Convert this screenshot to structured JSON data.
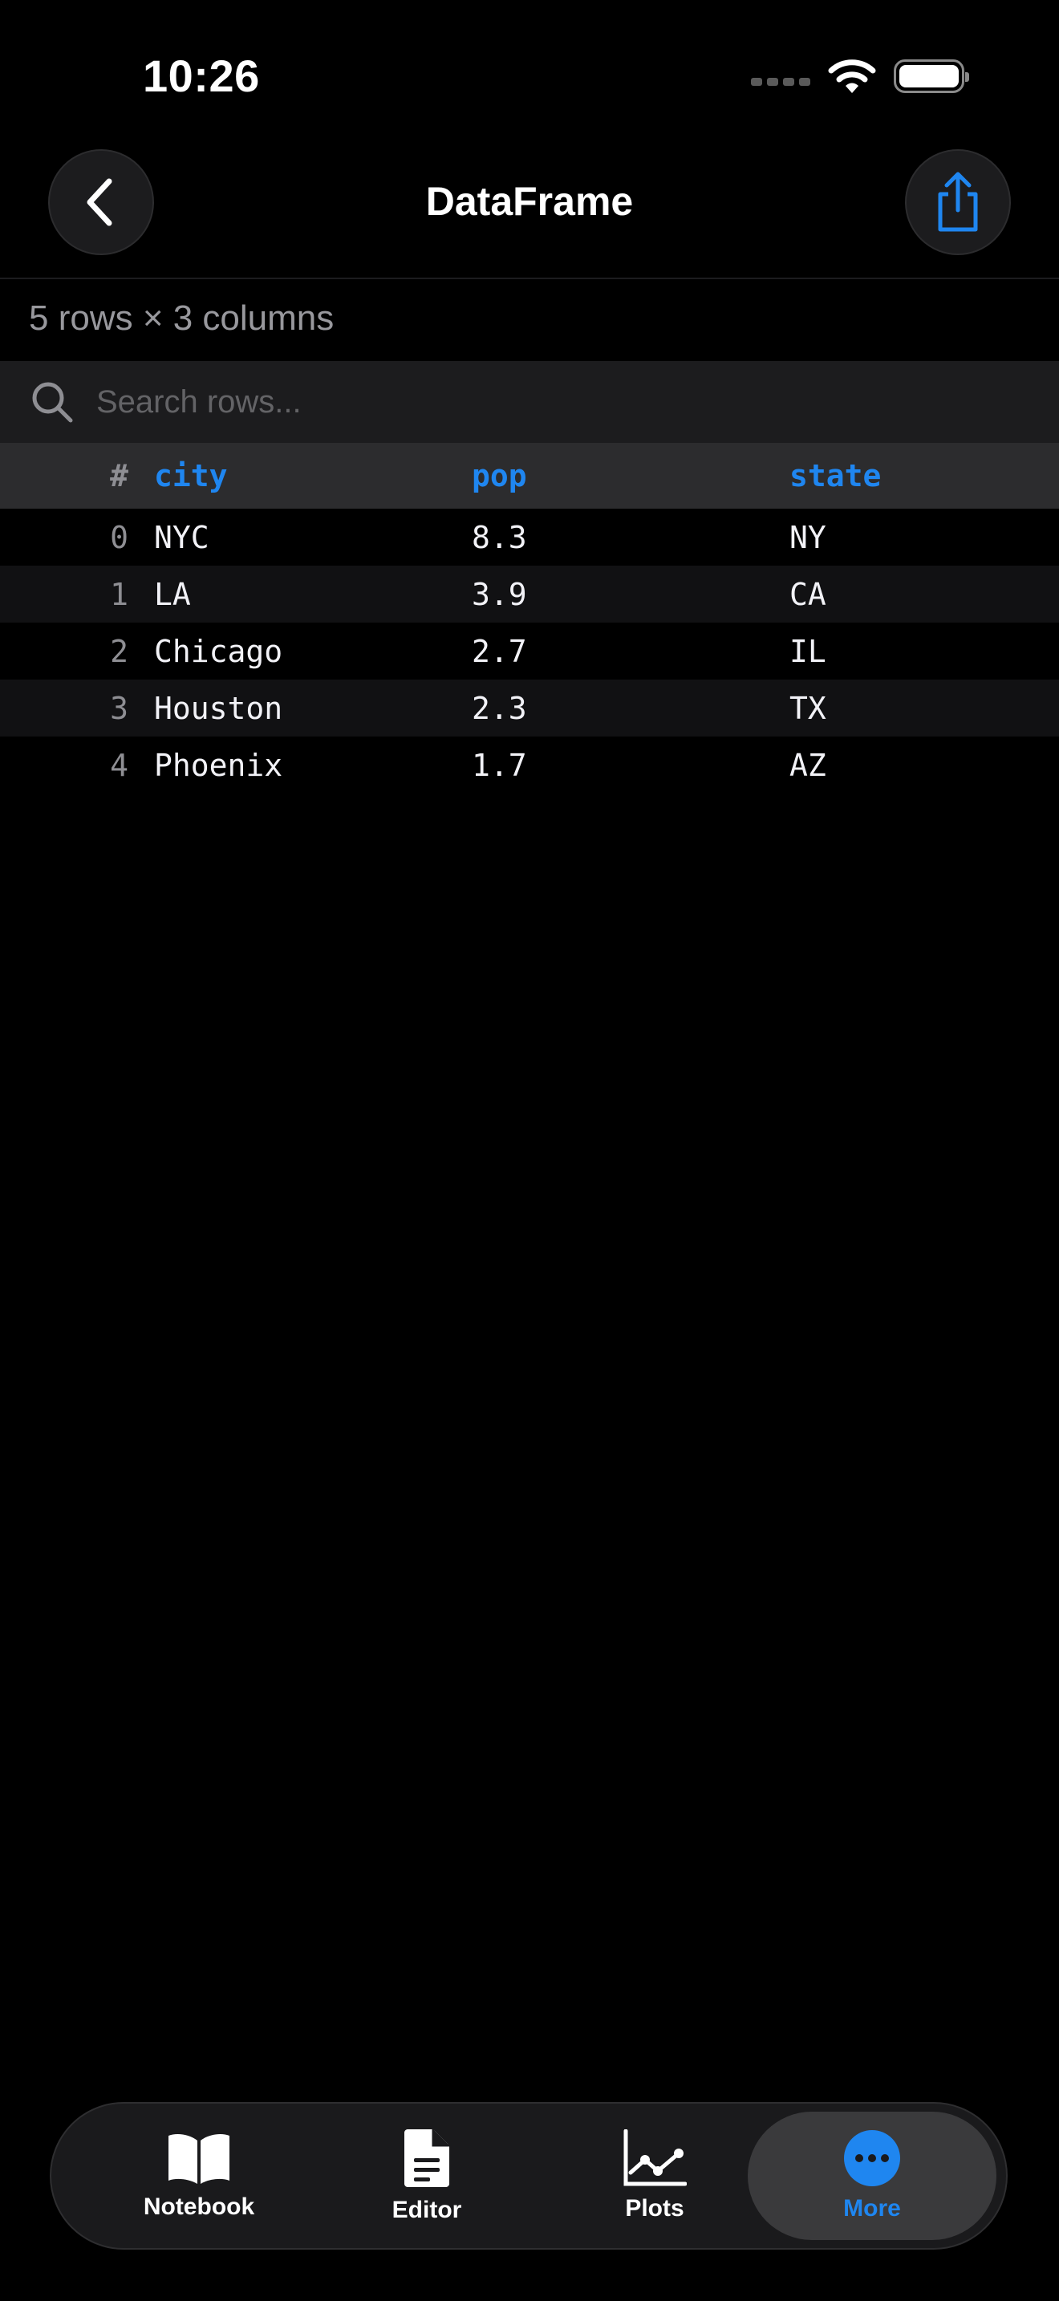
{
  "status_bar": {
    "time": "10:26"
  },
  "nav": {
    "title": "DataFrame"
  },
  "summary": "5 rows × 3 columns",
  "search": {
    "placeholder": "Search rows..."
  },
  "table": {
    "index_header": "#",
    "columns": [
      "city",
      "pop",
      "state"
    ],
    "rows": [
      {
        "index": "0",
        "city": "NYC",
        "pop": "8.3",
        "state": "NY"
      },
      {
        "index": "1",
        "city": "LA",
        "pop": "3.9",
        "state": "CA"
      },
      {
        "index": "2",
        "city": "Chicago",
        "pop": "2.7",
        "state": "IL"
      },
      {
        "index": "3",
        "city": "Houston",
        "pop": "2.3",
        "state": "TX"
      },
      {
        "index": "4",
        "city": "Phoenix",
        "pop": "1.7",
        "state": "AZ"
      }
    ]
  },
  "tabs": [
    {
      "label": "Notebook",
      "icon": "book-icon",
      "active": false
    },
    {
      "label": "Editor",
      "icon": "document-icon",
      "active": false
    },
    {
      "label": "Plots",
      "icon": "line-chart-icon",
      "active": false
    },
    {
      "label": "More",
      "icon": "ellipsis-circle-icon",
      "active": true
    }
  ],
  "colors": {
    "accent": "#1f86f0",
    "background": "#000000",
    "surface": "#1c1c1e",
    "header_row": "#2c2c2e"
  }
}
